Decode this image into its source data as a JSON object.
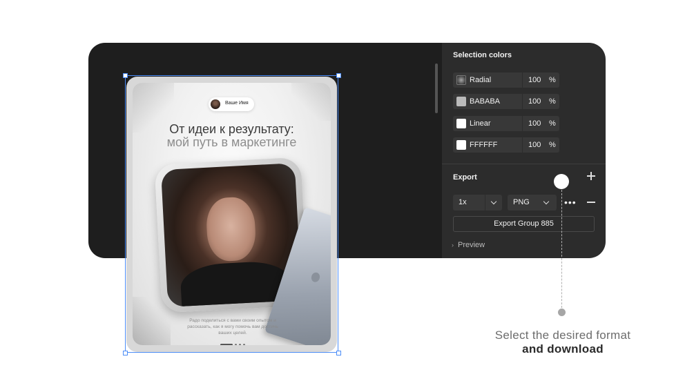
{
  "panel": {
    "selection_colors_title": "Selection colors",
    "colors": [
      {
        "name": "Radial",
        "percent": "100",
        "unit": "%",
        "swatch": "radial-gradient"
      },
      {
        "name": "BABABA",
        "percent": "100",
        "unit": "%",
        "swatch": "#BABABA"
      },
      {
        "name": "Linear",
        "percent": "100",
        "unit": "%",
        "swatch": "#FFFFFF"
      },
      {
        "name": "FFFFFF",
        "percent": "100",
        "unit": "%",
        "swatch": "#FFFFFF"
      }
    ],
    "export_title": "Export",
    "scale_value": "1x",
    "format_value": "PNG",
    "more_label": "•••",
    "export_button": "Export Group 885",
    "preview_label": "Preview",
    "icons": {
      "add": "plus-icon",
      "remove": "minus-icon",
      "more": "more-icon",
      "expand": "chevron-right-icon"
    }
  },
  "artboard": {
    "name_pill": "Ваше Имя",
    "headline_line1": "От идеи к результату:",
    "headline_line2": "мой путь в маркетинге",
    "bottom_text": "Радо поделиться с вами своим опытом и рассказать, как я могу помочь вам достичь ваших целей."
  },
  "caption": {
    "line1": "Select the desired format",
    "line2": "and download"
  },
  "colors": {
    "canvas": "#1e1e1e",
    "panel": "#2c2c2c",
    "selection": "#4a8cf7"
  }
}
